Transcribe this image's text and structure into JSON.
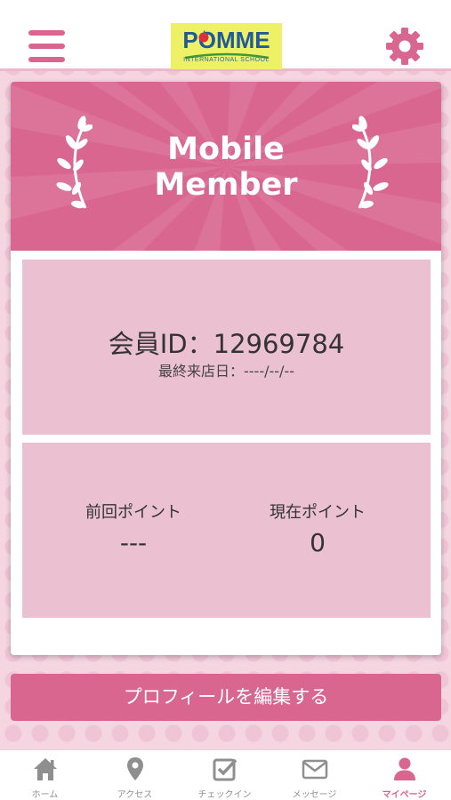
{
  "header": {
    "menu_icon": "hamburger-menu-icon",
    "settings_icon": "gear-icon",
    "logo": {
      "name": "POMME",
      "sub": "INTERNATIONAL SCHOOL",
      "color_bg": "#eef166",
      "color_text": "#1f5a9a"
    }
  },
  "banner": {
    "title_line1": "Mobile",
    "title_line2": "Member"
  },
  "member": {
    "id_text": "会員ID：12969784",
    "last_visit_text": "最終来店日：----/--/--"
  },
  "points": {
    "previous_label": "前回ポイント",
    "previous_value": "---",
    "current_label": "現在ポイント",
    "current_value": "0"
  },
  "edit_button_label": "プロフィールを編集する",
  "tabs": [
    {
      "label": "ホーム",
      "icon": "home-icon"
    },
    {
      "label": "アクセス",
      "icon": "map-pin-icon"
    },
    {
      "label": "チェックイン",
      "icon": "checkin-icon"
    },
    {
      "label": "メッセージ",
      "icon": "mail-icon"
    },
    {
      "label": "マイページ",
      "icon": "user-icon",
      "active": true
    }
  ],
  "colors": {
    "accent": "#d9668f",
    "panel": "#ebc0d1",
    "background": "#f4d5e0",
    "inactive_tab": "#8f8f8f"
  }
}
